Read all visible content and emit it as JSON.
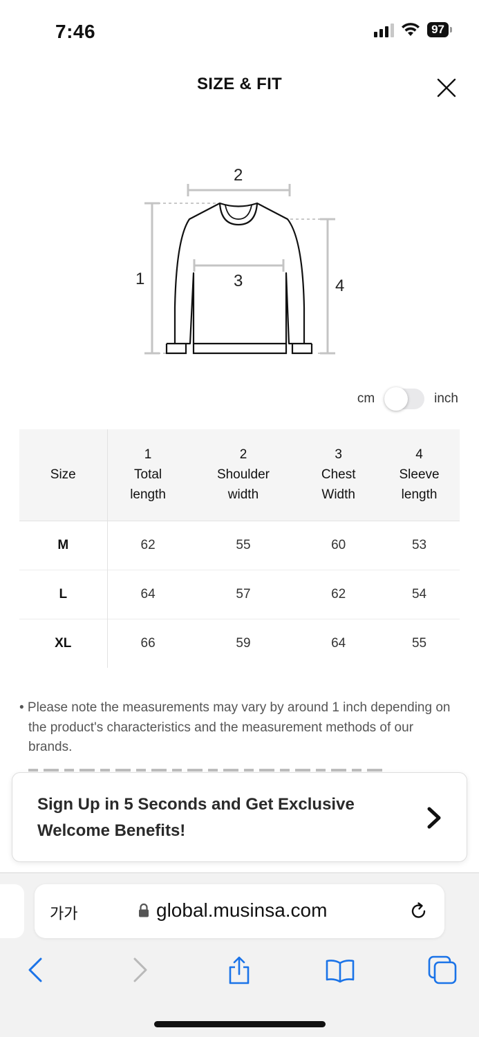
{
  "status_bar": {
    "time": "7:46",
    "battery": "97"
  },
  "header": {
    "title": "SIZE & FIT"
  },
  "diagram": {
    "labels": [
      "1",
      "2",
      "3",
      "4"
    ]
  },
  "units": {
    "left": "cm",
    "right": "inch",
    "selected": "cm"
  },
  "table": {
    "size_header": "Size",
    "columns": [
      {
        "num": "1",
        "name": "Total length"
      },
      {
        "num": "2",
        "name": "Shoulder width"
      },
      {
        "num": "3",
        "name": "Chest Width"
      },
      {
        "num": "4",
        "name": "Sleeve length"
      }
    ],
    "rows": [
      {
        "size": "M",
        "values": [
          "62",
          "55",
          "60",
          "53"
        ]
      },
      {
        "size": "L",
        "values": [
          "64",
          "57",
          "62",
          "54"
        ]
      },
      {
        "size": "XL",
        "values": [
          "66",
          "59",
          "64",
          "55"
        ]
      }
    ]
  },
  "note": {
    "text": "• Please note the measurements may vary by around 1 inch depending on the product's characteristics and the measurement methods of our brands."
  },
  "signup": {
    "text": "Sign Up in 5 Seconds and Get Exclusive Welcome Benefits!"
  },
  "browser": {
    "aa_label": "가가",
    "url": "global.musinsa.com"
  }
}
